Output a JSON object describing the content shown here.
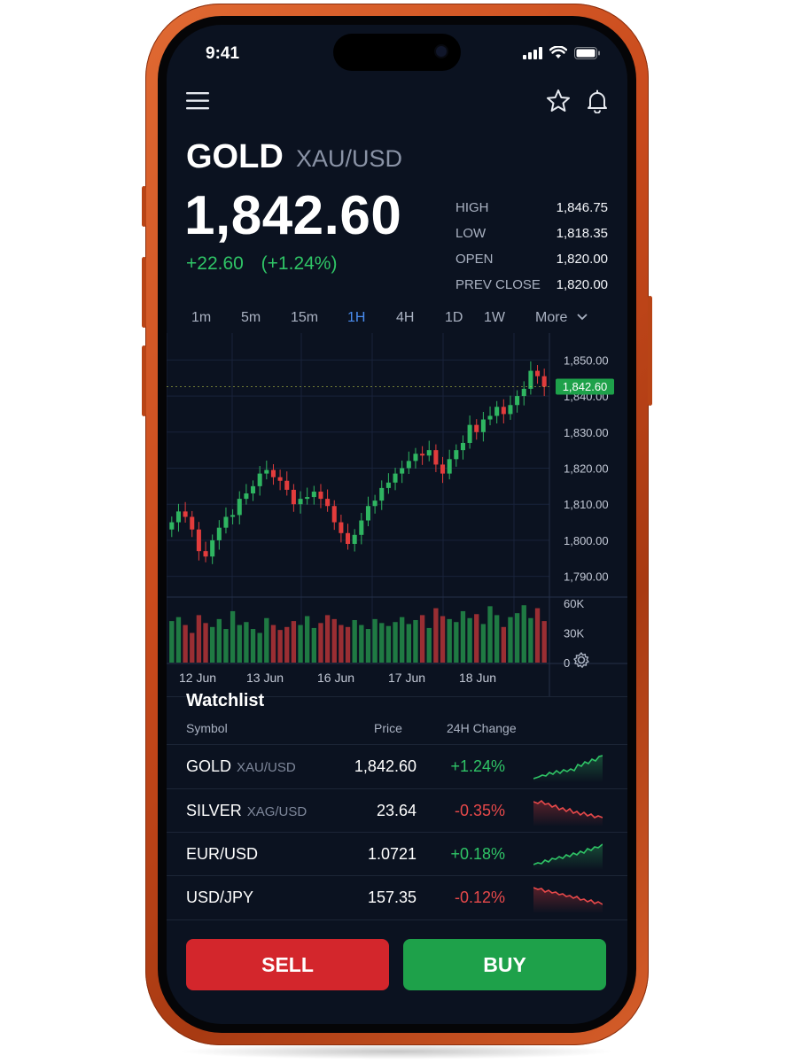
{
  "status": {
    "time": "9:41"
  },
  "header": {
    "icons": [
      "menu-icon",
      "star-icon",
      "bell-icon"
    ]
  },
  "instrument": {
    "symbol": "GOLD",
    "pair": "XAU/USD",
    "price": "1,842.60",
    "change": "+22.60",
    "change_pct": "(+1.24%)"
  },
  "stats": [
    {
      "label": "HIGH",
      "value": "1,846.75"
    },
    {
      "label": "LOW",
      "value": "1,818.35"
    },
    {
      "label": "OPEN",
      "value": "1,820.00"
    },
    {
      "label": "PREV CLOSE",
      "value": "1,820.00"
    }
  ],
  "timeframes": {
    "items": [
      "1m",
      "5m",
      "15m",
      "1H",
      "4H",
      "1D",
      "1W",
      "More"
    ],
    "active": "1H"
  },
  "chart": {
    "price_axis": [
      "1,850.00",
      "1,840.00",
      "1,830.00",
      "1,820.00",
      "1,810.00",
      "1,800.00",
      "1,790.00"
    ],
    "current_price_tag": "1,842.60",
    "volume_axis": [
      "60K",
      "30K",
      "0"
    ],
    "date_labels": [
      "12 Jun",
      "13 Jun",
      "16 Jun",
      "17 Jun",
      "18 Jun"
    ],
    "up_color": "#2fb561",
    "down_color": "#e23c3c"
  },
  "chart_data": {
    "type": "candlestick",
    "ylim": [
      1785,
      1855
    ],
    "volume_ylim": [
      0,
      60000
    ],
    "last_price": 1842.6,
    "x_ticks": [
      "12 Jun",
      "13 Jun",
      "16 Jun",
      "17 Jun",
      "18 Jun"
    ],
    "close": [
      1805.0,
      1808.0,
      1806.5,
      1803.0,
      1797.0,
      1795.5,
      1800.0,
      1803.5,
      1806.5,
      1807.0,
      1811.5,
      1813.0,
      1815.0,
      1818.5,
      1819.5,
      1817.5,
      1816.5,
      1814.0,
      1810.0,
      1811.5,
      1812.0,
      1813.5,
      1811.5,
      1809.5,
      1805.0,
      1802.0,
      1799.0,
      1801.5,
      1805.5,
      1809.5,
      1811.0,
      1814.5,
      1816.0,
      1818.5,
      1820.0,
      1822.0,
      1824.0,
      1823.5,
      1825.0,
      1821.0,
      1818.5,
      1822.5,
      1825.0,
      1827.0,
      1832.0,
      1830.0,
      1833.5,
      1834.5,
      1837.0,
      1835.0,
      1837.5,
      1840.0,
      1842.0,
      1847.0,
      1845.5,
      1842.6
    ],
    "open": [
      1803.0,
      1805.0,
      1808.0,
      1806.5,
      1803.0,
      1797.0,
      1795.5,
      1800.0,
      1803.5,
      1806.5,
      1807.0,
      1811.5,
      1813.0,
      1815.0,
      1818.5,
      1819.5,
      1817.5,
      1816.5,
      1814.0,
      1810.0,
      1811.5,
      1812.0,
      1813.5,
      1811.5,
      1809.5,
      1805.0,
      1802.0,
      1799.0,
      1801.5,
      1805.5,
      1809.5,
      1811.0,
      1814.5,
      1816.0,
      1818.5,
      1820.0,
      1822.0,
      1824.0,
      1823.5,
      1825.0,
      1821.0,
      1818.5,
      1822.5,
      1825.0,
      1827.0,
      1832.0,
      1830.0,
      1833.5,
      1834.5,
      1837.0,
      1835.0,
      1837.5,
      1840.0,
      1842.0,
      1847.0,
      1845.5
    ],
    "volume_k": [
      42,
      46,
      38,
      30,
      48,
      40,
      36,
      44,
      34,
      52,
      38,
      41,
      34,
      30,
      45,
      38,
      33,
      36,
      42,
      38,
      47,
      35,
      40,
      48,
      44,
      38,
      36,
      43,
      38,
      34,
      44,
      40,
      37,
      41,
      46,
      39,
      43,
      48,
      35,
      55,
      47,
      44,
      41,
      52,
      45,
      49,
      39,
      57,
      48,
      36,
      46,
      50,
      58,
      45,
      55,
      42
    ]
  },
  "watchlist": {
    "title": "Watchlist",
    "headers": {
      "symbol": "Symbol",
      "price": "Price",
      "change": "24H Change"
    },
    "rows": [
      {
        "symbol": "GOLD",
        "pair": "XAU/USD",
        "price": "1,842.60",
        "change": "+1.24%",
        "trend": "up"
      },
      {
        "symbol": "SILVER",
        "pair": "XAG/USD",
        "price": "23.64",
        "change": "-0.35%",
        "trend": "down"
      },
      {
        "symbol": "EUR/USD",
        "pair": "",
        "price": "1.0721",
        "change": "+0.18%",
        "trend": "up"
      },
      {
        "symbol": "USD/JPY",
        "pair": "",
        "price": "157.35",
        "change": "-0.12%",
        "trend": "down"
      }
    ]
  },
  "actions": {
    "sell": "SELL",
    "buy": "BUY"
  }
}
